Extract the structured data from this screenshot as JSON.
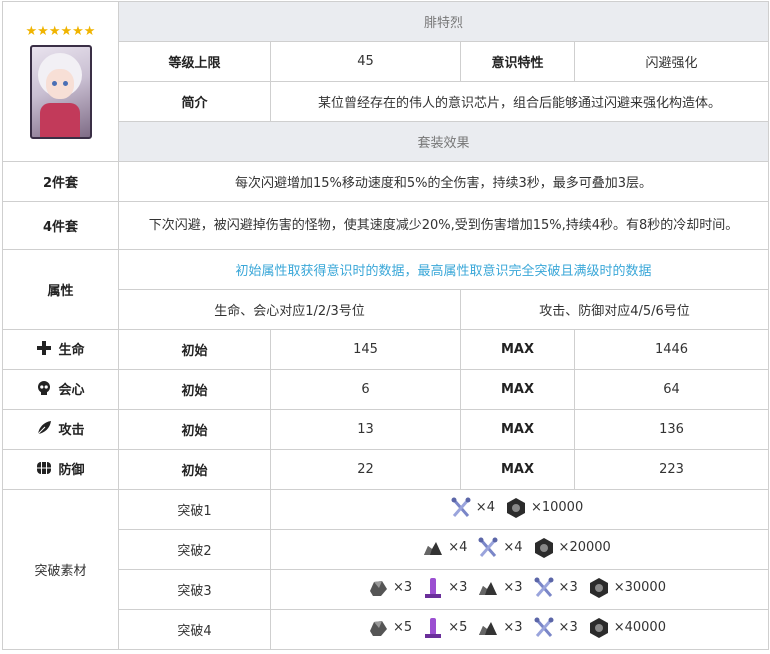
{
  "header": {
    "stars": "★★★★★★",
    "name": "腓特烈",
    "max_level_label": "等级上限",
    "max_level_value": "45",
    "trait_label": "意识特性",
    "trait_value": "闪避强化",
    "intro_label": "简介",
    "intro_text": "某位曾经存在的伟人的意识芯片，组合后能够通过闪避来强化构造体。",
    "set_effect_title": "套装效果"
  },
  "set_effects": [
    {
      "label": "2件套",
      "text": "每次闪避增加15%移动速度和5%的全伤害，持续3秒，最多可叠加3层。"
    },
    {
      "label": "4件套",
      "text": "下次闪避，被闪避掉伤害的怪物，使其速度减少20%,受到伤害增加15%,持续4秒。有8秒的冷却时间。"
    }
  ],
  "attributes": {
    "label": "属性",
    "note": "初始属性取获得意识时的数据，最高属性取意识完全突破且满级时的数据",
    "col_left": "生命、会心对应1/2/3号位",
    "col_right": "攻击、防御对应4/5/6号位",
    "initial_label": "初始",
    "max_label": "MAX",
    "stats": [
      {
        "name": "生命",
        "icon": "plus-icon",
        "initial": "145",
        "max": "1446"
      },
      {
        "name": "会心",
        "icon": "skull-icon",
        "initial": "6",
        "max": "64"
      },
      {
        "name": "攻击",
        "icon": "leaf-blade-icon",
        "initial": "13",
        "max": "136"
      },
      {
        "name": "防御",
        "icon": "shield-grid-icon",
        "initial": "22",
        "max": "223"
      }
    ]
  },
  "breakthrough": {
    "label": "突破素材",
    "rows": [
      {
        "name": "突破1",
        "items": [
          {
            "icon": "crossed-wrench-icon",
            "count": "×4"
          },
          {
            "icon": "hex-nut-icon",
            "count": "×10000"
          }
        ]
      },
      {
        "name": "突破2",
        "items": [
          {
            "icon": "ore-chunk-icon",
            "count": "×4"
          },
          {
            "icon": "crossed-wrench-icon",
            "count": "×4"
          },
          {
            "icon": "hex-nut-icon",
            "count": "×20000"
          }
        ]
      },
      {
        "name": "突破3",
        "items": [
          {
            "icon": "gray-ore-icon",
            "count": "×3"
          },
          {
            "icon": "purple-tube-icon",
            "count": "×3"
          },
          {
            "icon": "ore-chunk-icon",
            "count": "×3"
          },
          {
            "icon": "crossed-wrench-icon",
            "count": "×3"
          },
          {
            "icon": "hex-nut-icon",
            "count": "×30000"
          }
        ]
      },
      {
        "name": "突破4",
        "items": [
          {
            "icon": "gray-ore-icon",
            "count": "×5"
          },
          {
            "icon": "purple-tube-icon",
            "count": "×5"
          },
          {
            "icon": "ore-chunk-icon",
            "count": "×3"
          },
          {
            "icon": "crossed-wrench-icon",
            "count": "×3"
          },
          {
            "icon": "hex-nut-icon",
            "count": "×40000"
          }
        ]
      }
    ]
  },
  "colors": {
    "accent_blue": "#3aa7d8",
    "star_gold": "#f0b400",
    "header_gray": "#eaecf0"
  }
}
